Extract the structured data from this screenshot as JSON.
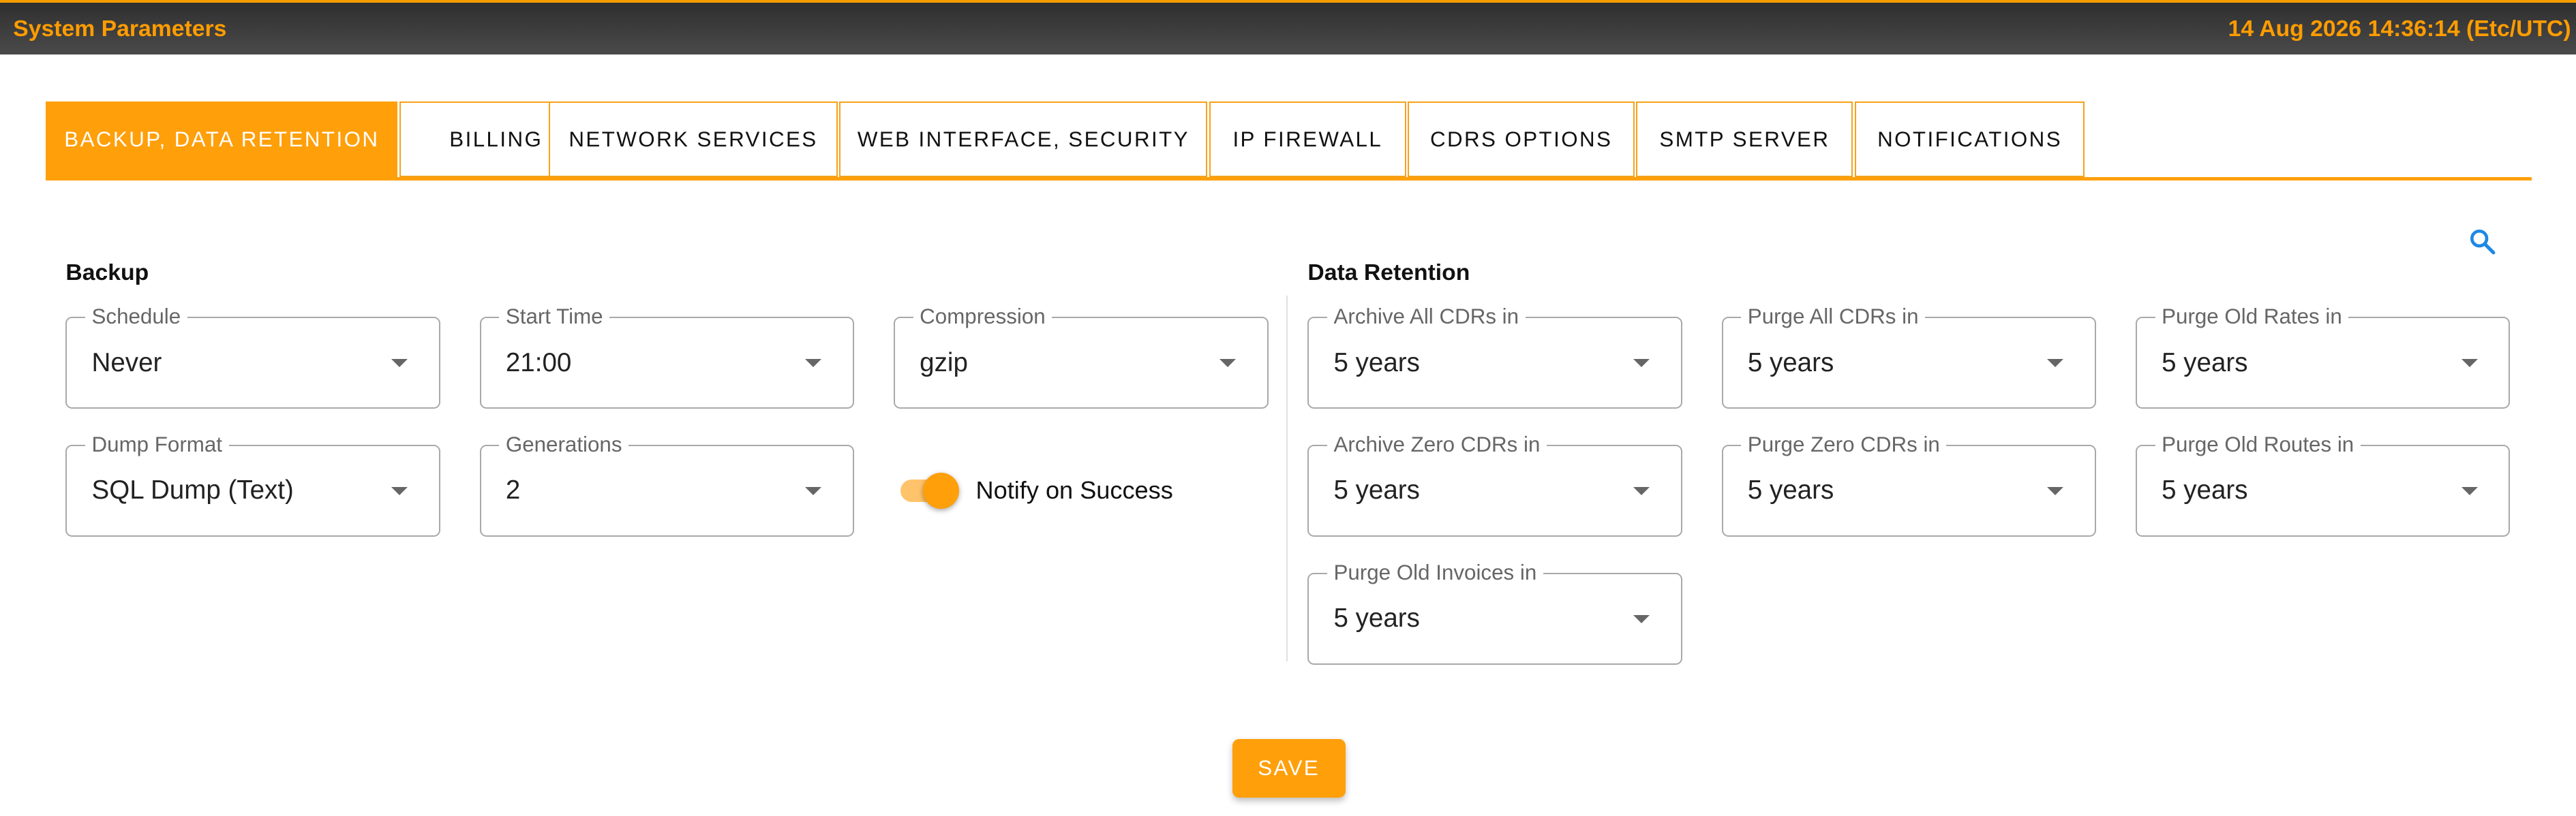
{
  "header": {
    "title": "System Parameters",
    "datetime": "14 Aug 2026 14:36:14 (Etc/UTC)"
  },
  "tabs": [
    {
      "label": "BACKUP, DATA RETENTION",
      "active": true
    },
    {
      "label": "BILLING"
    },
    {
      "label": "NETWORK SERVICES"
    },
    {
      "label": "WEB INTERFACE, SECURITY"
    },
    {
      "label": "IP FIREWALL"
    },
    {
      "label": "CDRS OPTIONS"
    },
    {
      "label": "SMTP SERVER"
    },
    {
      "label": "NOTIFICATIONS"
    }
  ],
  "backup": {
    "title": "Backup",
    "schedule": {
      "label": "Schedule",
      "value": "Never"
    },
    "start_time": {
      "label": "Start Time",
      "value": "21:00"
    },
    "compression": {
      "label": "Compression",
      "value": "gzip"
    },
    "dump_format": {
      "label": "Dump Format",
      "value": "SQL Dump (Text)"
    },
    "generations": {
      "label": "Generations",
      "value": "2"
    },
    "notify_on_success": {
      "label": "Notify on Success",
      "checked": true
    }
  },
  "retention": {
    "title": "Data Retention",
    "archive_all_cdrs": {
      "label": "Archive All CDRs in",
      "value": "5 years"
    },
    "purge_all_cdrs": {
      "label": "Purge All CDRs in",
      "value": "5 years"
    },
    "purge_old_rates": {
      "label": "Purge Old Rates in",
      "value": "5 years"
    },
    "archive_zero_cdrs": {
      "label": "Archive Zero CDRs in",
      "value": "5 years"
    },
    "purge_zero_cdrs": {
      "label": "Purge Zero CDRs in",
      "value": "5 years"
    },
    "purge_old_routes": {
      "label": "Purge Old Routes in",
      "value": "5 years"
    },
    "purge_old_invoices": {
      "label": "Purge Old Invoices in",
      "value": "5 years"
    }
  },
  "actions": {
    "save_label": "SAVE"
  },
  "colors": {
    "accent": "#ff9f0a",
    "header_bg": "#3b3b3b",
    "search_icon": "#1e88e5"
  },
  "icons": {
    "search": "search-icon",
    "dropdown": "chevron-down-icon"
  }
}
